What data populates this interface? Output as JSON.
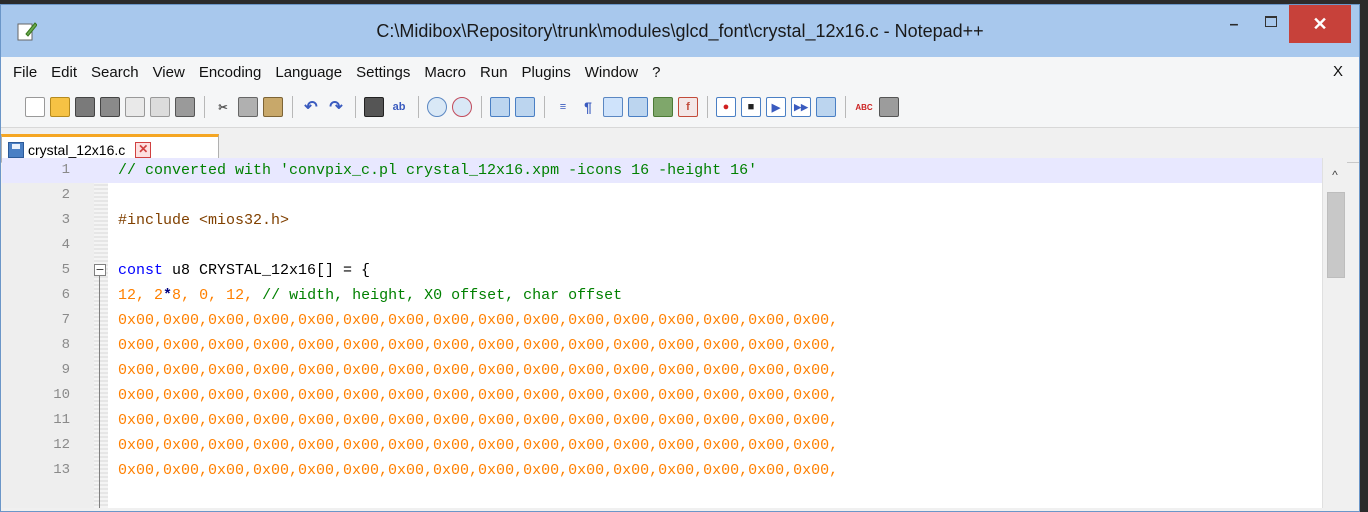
{
  "window": {
    "title": "C:\\Midibox\\Repository\\trunk\\modules\\glcd_font\\crystal_12x16.c - Notepad++",
    "minimize": "–",
    "close": "✕"
  },
  "menu": {
    "items": [
      "File",
      "Edit",
      "Search",
      "View",
      "Encoding",
      "Language",
      "Settings",
      "Macro",
      "Run",
      "Plugins",
      "Window",
      "?"
    ],
    "close_doc": "X"
  },
  "toolbar": {
    "icons": [
      "new-file",
      "open-file",
      "save",
      "save-all",
      "close",
      "close-all",
      "print",
      "cut",
      "copy",
      "paste",
      "undo",
      "redo",
      "find",
      "replace",
      "zoom-in",
      "zoom-out",
      "sync-vertical",
      "sync-horizontal",
      "word-wrap",
      "show-all-characters",
      "indent-guide",
      "user-defined-language",
      "document-map",
      "function-list",
      "record-macro",
      "stop-recording",
      "play-macro",
      "run-macro-multiple",
      "save-macro",
      "spell-check",
      "tools"
    ]
  },
  "tab": {
    "label": "crystal_12x16.c"
  },
  "editor": {
    "lines": [
      {
        "n": "1",
        "text": "// converted with 'convpix_c.pl crystal_12x16.xpm -icons 16 -height 16'"
      },
      {
        "n": "2",
        "text": ""
      },
      {
        "n": "3",
        "text": "#include <mios32.h>"
      },
      {
        "n": "4",
        "text": ""
      },
      {
        "n": "5",
        "kw": "const",
        "rest": " u8 CRYSTAL_12x16[] = {"
      },
      {
        "n": "6",
        "a": "12",
        "b": ", 2",
        "c": "*",
        "d": "8",
        "e": ", 0, 12, ",
        "f": "// width, height, X0 offset, char offset"
      },
      {
        "n": "7",
        "text": "0x00,0x00,0x00,0x00,0x00,0x00,0x00,0x00,0x00,0x00,0x00,0x00,0x00,0x00,0x00,0x00,"
      },
      {
        "n": "8",
        "text": "0x00,0x00,0x00,0x00,0x00,0x00,0x00,0x00,0x00,0x00,0x00,0x00,0x00,0x00,0x00,0x00,"
      },
      {
        "n": "9",
        "text": "0x00,0x00,0x00,0x00,0x00,0x00,0x00,0x00,0x00,0x00,0x00,0x00,0x00,0x00,0x00,0x00,"
      },
      {
        "n": "10",
        "text": "0x00,0x00,0x00,0x00,0x00,0x00,0x00,0x00,0x00,0x00,0x00,0x00,0x00,0x00,0x00,0x00,"
      },
      {
        "n": "11",
        "text": "0x00,0x00,0x00,0x00,0x00,0x00,0x00,0x00,0x00,0x00,0x00,0x00,0x00,0x00,0x00,0x00,"
      },
      {
        "n": "12",
        "text": "0x00,0x00,0x00,0x00,0x00,0x00,0x00,0x00,0x00,0x00,0x00,0x00,0x00,0x00,0x00,0x00,"
      },
      {
        "n": "13",
        "text": "0x00,0x00,0x00,0x00,0x00,0x00,0x00,0x00,0x00,0x00,0x00,0x00,0x00,0x00,0x00,0x00,"
      }
    ]
  },
  "colors": {
    "titlebar": "#a8c8ed",
    "close_button": "#c7413a",
    "current_line": "#e8e8ff",
    "comment": "#008000",
    "preprocessor": "#804000",
    "keyword": "#0000ff",
    "number": "#ff8000"
  }
}
